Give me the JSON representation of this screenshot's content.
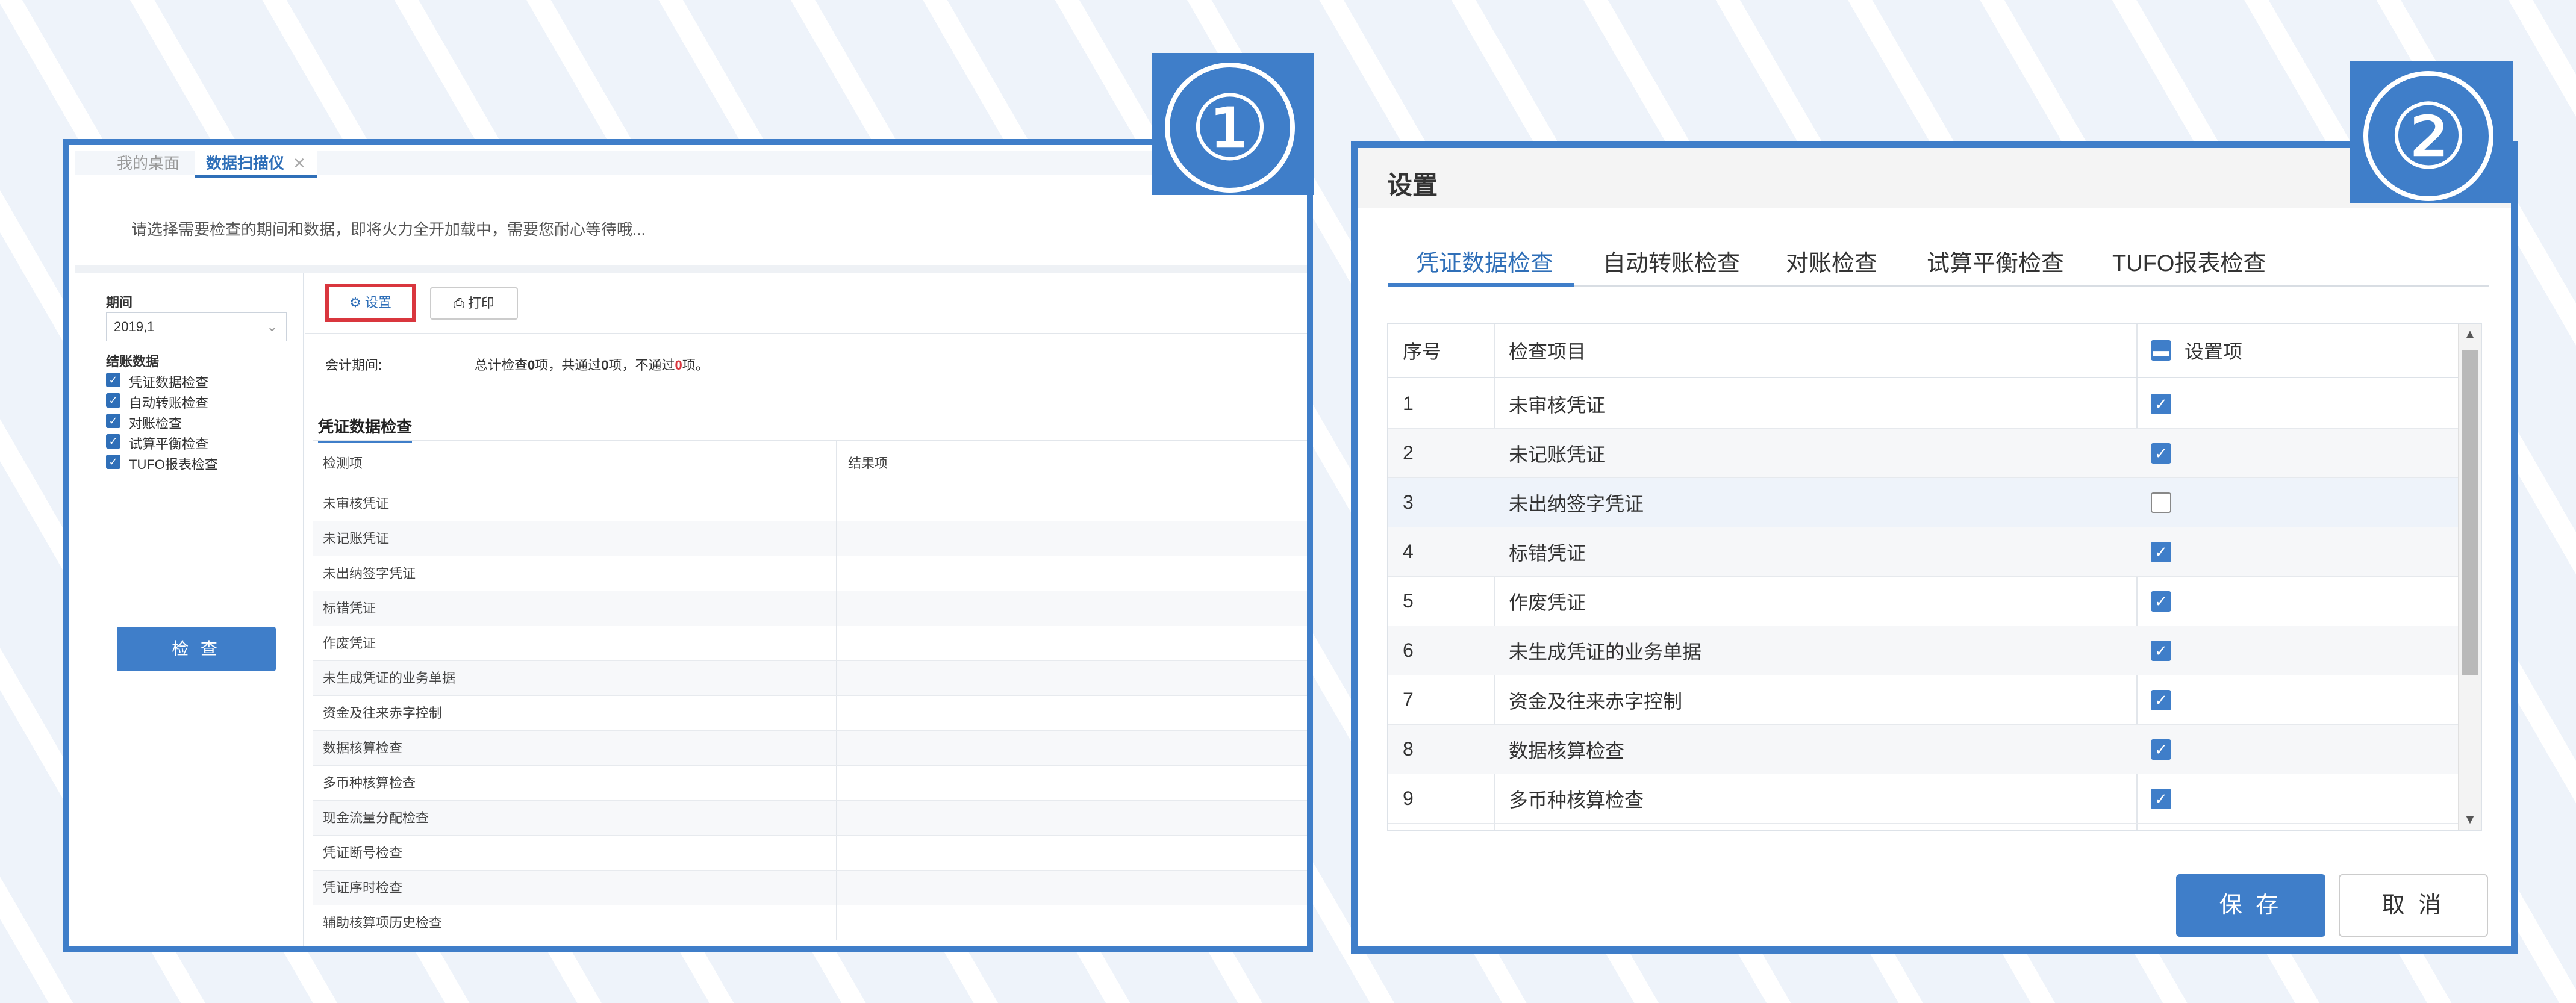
{
  "panel1": {
    "badge": "①",
    "tabs": {
      "home": "我的桌面",
      "scanner": "数据扫描仪",
      "close": "✕"
    },
    "notice": "请选择需要检查的期间和数据，即将火力全开加载中，需要您耐心等待哦...",
    "period_label": "期间",
    "period_value": "2019,1",
    "closing_label": "结账数据",
    "checks": [
      "凭证数据检查",
      "自动转账检查",
      "对账检查",
      "试算平衡检查",
      "TUFO报表检查"
    ],
    "check_button": "检 查",
    "settings_button": "设置",
    "print_button": "打印",
    "accounting_period_label": "会计期间:",
    "summary": {
      "pre": "总计检查",
      "total": "0",
      "mid1": "项，共通过",
      "passed": "0",
      "mid2": "项，不通过",
      "failed": "0",
      "post": "项。"
    },
    "section_title": "凭证数据检查",
    "table_headers": {
      "item": "检测项",
      "result": "结果项"
    },
    "rows": [
      "未审核凭证",
      "未记账凭证",
      "未出纳签字凭证",
      "标错凭证",
      "作废凭证",
      "未生成凭证的业务单据",
      "资金及往来赤字控制",
      "数据核算检查",
      "多币种核算检查",
      "现金流量分配检查",
      "凭证断号检查",
      "凭证序时检查",
      "辅助核算项历史检查"
    ]
  },
  "panel2": {
    "badge": "②",
    "title": "设置",
    "tabs": [
      "凭证数据检查",
      "自动转账检查",
      "对账检查",
      "试算平衡检查",
      "TUFO报表检查"
    ],
    "headers": {
      "no": "序号",
      "item": "检查项目",
      "setting": "设置项"
    },
    "rows": [
      {
        "no": "1",
        "item": "未审核凭证",
        "checked": true
      },
      {
        "no": "2",
        "item": "未记账凭证",
        "checked": true
      },
      {
        "no": "3",
        "item": "未出纳签字凭证",
        "checked": false
      },
      {
        "no": "4",
        "item": "标错凭证",
        "checked": true
      },
      {
        "no": "5",
        "item": "作废凭证",
        "checked": true
      },
      {
        "no": "6",
        "item": "未生成凭证的业务单据",
        "checked": true
      },
      {
        "no": "7",
        "item": "资金及往来赤字控制",
        "checked": true
      },
      {
        "no": "8",
        "item": "数据核算检查",
        "checked": true
      },
      {
        "no": "9",
        "item": "多币种核算检查",
        "checked": true
      }
    ],
    "save_button": "保 存",
    "cancel_button": "取 消"
  },
  "colors": {
    "accent": "#3f7ec9",
    "highlight": "#d9363e"
  }
}
